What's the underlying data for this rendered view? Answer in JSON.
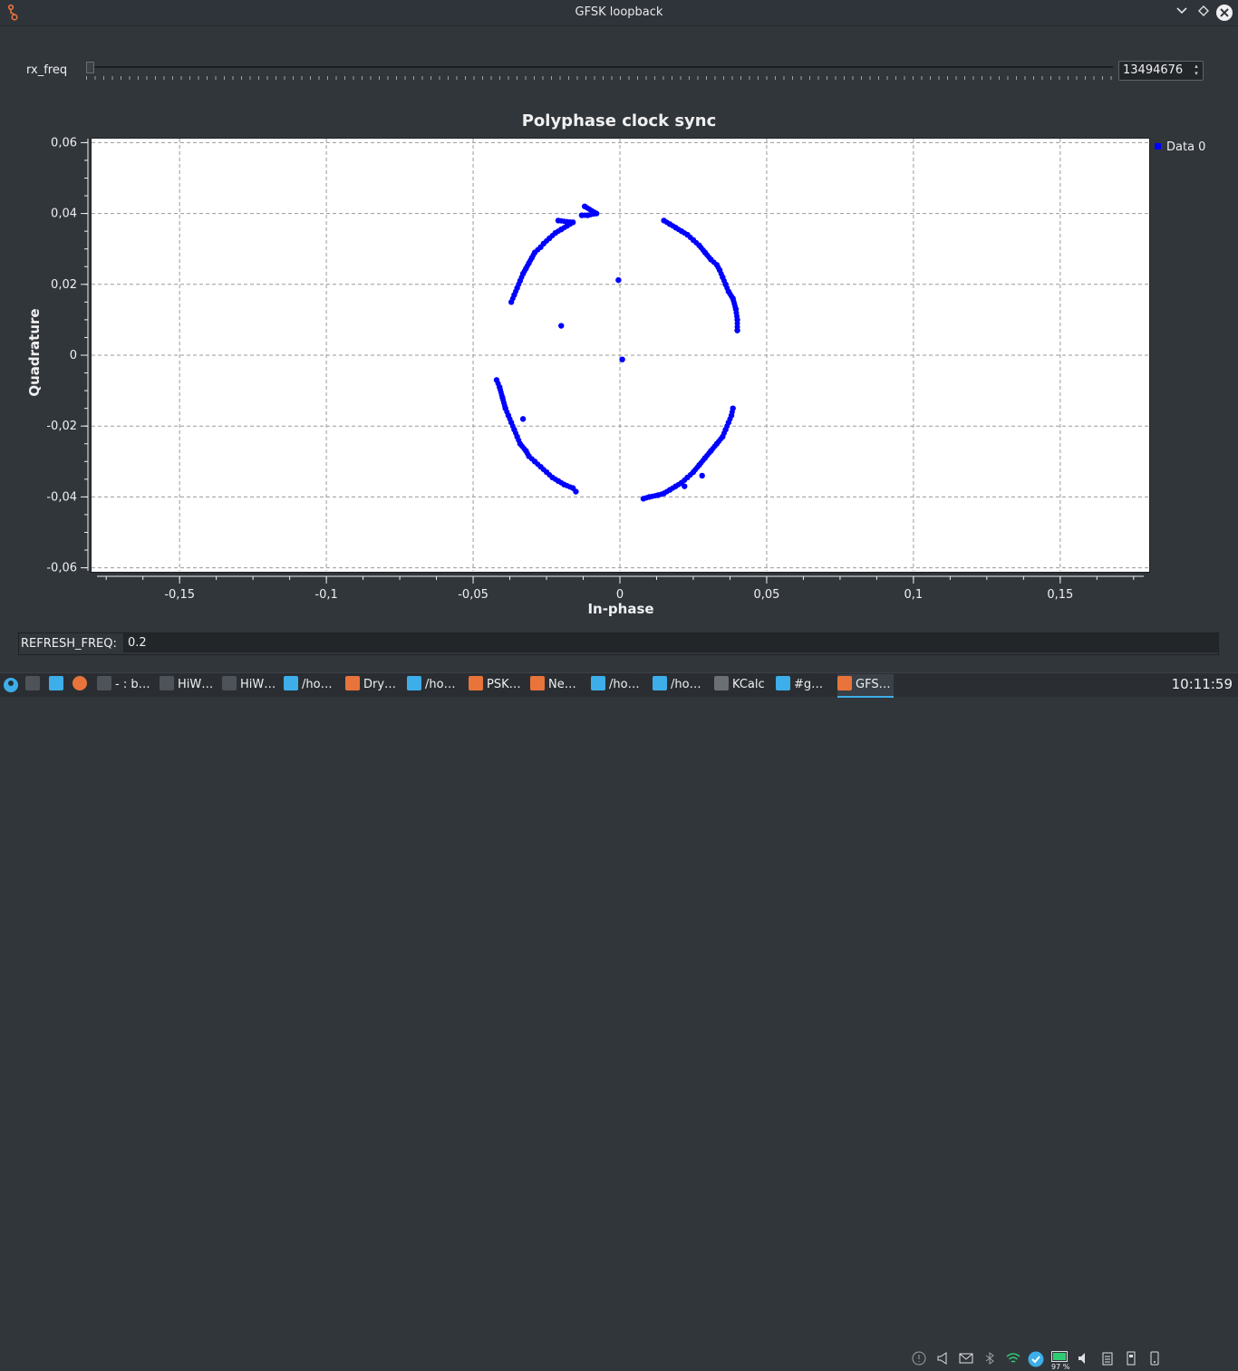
{
  "window": {
    "title": "GFSK loopback",
    "colors": {
      "accent": "#3daee9",
      "point": "#0000ff",
      "app_icon": "#e8743b"
    }
  },
  "controls": {
    "rx_freq_label": "rx_freq",
    "rx_freq_value": "13494676",
    "refresh_label": "REFRESH_FREQ:",
    "refresh_value": "0.2"
  },
  "chart_data": {
    "type": "scatter",
    "title": "Polyphase clock sync",
    "xlabel": "In-phase",
    "ylabel": "Quadrature",
    "xlim": [
      -0.18,
      0.18
    ],
    "ylim": [
      -0.06,
      0.06
    ],
    "xticks": [
      -0.15,
      -0.1,
      -0.05,
      0,
      0.05,
      0.1,
      0.15
    ],
    "xtick_labels": [
      "-0,15",
      "-0,1",
      "-0,05",
      "0",
      "0,05",
      "0,1",
      "0,15"
    ],
    "yticks": [
      0.06,
      0.04,
      0.02,
      0,
      -0.02,
      -0.04,
      -0.06
    ],
    "ytick_labels": [
      "0,06",
      "0,04",
      "0,02",
      "0",
      "-0,02",
      "-0,04",
      "-0,06"
    ],
    "grid": true,
    "legend": "right",
    "series": [
      {
        "name": "Data 0",
        "color": "#0000ff",
        "points": [
          [
            -0.037,
            0.015
          ],
          [
            -0.036,
            0.017
          ],
          [
            -0.035,
            0.019
          ],
          [
            -0.034,
            0.021
          ],
          [
            -0.033,
            0.023
          ],
          [
            -0.032,
            0.0245
          ],
          [
            -0.031,
            0.026
          ],
          [
            -0.03,
            0.0275
          ],
          [
            -0.029,
            0.029
          ],
          [
            -0.027,
            0.0305
          ],
          [
            -0.026,
            0.0315
          ],
          [
            -0.024,
            0.033
          ],
          [
            -0.022,
            0.0345
          ],
          [
            -0.02,
            0.0355
          ],
          [
            -0.018,
            0.0365
          ],
          [
            -0.016,
            0.0375
          ],
          [
            -0.021,
            0.038
          ],
          [
            -0.013,
            0.0395
          ],
          [
            -0.011,
            0.0395
          ],
          [
            -0.008,
            0.04
          ],
          [
            -0.012,
            0.042
          ],
          [
            0.015,
            0.038
          ],
          [
            0.017,
            0.037
          ],
          [
            0.019,
            0.036
          ],
          [
            0.021,
            0.035
          ],
          [
            0.023,
            0.034
          ],
          [
            0.025,
            0.0325
          ],
          [
            0.027,
            0.031
          ],
          [
            0.029,
            0.029
          ],
          [
            0.031,
            0.027
          ],
          [
            0.033,
            0.0255
          ],
          [
            0.034,
            0.024
          ],
          [
            0.035,
            0.022
          ],
          [
            0.036,
            0.02
          ],
          [
            0.037,
            0.018
          ],
          [
            0.0385,
            0.016
          ],
          [
            0.0395,
            0.013
          ],
          [
            0.04,
            0.01
          ],
          [
            0.04,
            0.007
          ],
          [
            -0.042,
            -0.007
          ],
          [
            -0.041,
            -0.009
          ],
          [
            -0.04,
            -0.012
          ],
          [
            -0.039,
            -0.015
          ],
          [
            -0.038,
            -0.017
          ],
          [
            -0.037,
            -0.019
          ],
          [
            -0.036,
            -0.021
          ],
          [
            -0.035,
            -0.023
          ],
          [
            -0.034,
            -0.025
          ],
          [
            -0.032,
            -0.027
          ],
          [
            -0.031,
            -0.0285
          ],
          [
            -0.029,
            -0.03
          ],
          [
            -0.027,
            -0.0315
          ],
          [
            -0.025,
            -0.033
          ],
          [
            -0.023,
            -0.0345
          ],
          [
            -0.021,
            -0.0355
          ],
          [
            -0.019,
            -0.0365
          ],
          [
            -0.016,
            -0.0375
          ],
          [
            -0.015,
            -0.0385
          ],
          [
            -0.033,
            -0.018
          ],
          [
            0.008,
            -0.0405
          ],
          [
            0.01,
            -0.04
          ],
          [
            0.013,
            -0.0395
          ],
          [
            0.015,
            -0.039
          ],
          [
            0.017,
            -0.038
          ],
          [
            0.019,
            -0.037
          ],
          [
            0.021,
            -0.036
          ],
          [
            0.023,
            -0.0345
          ],
          [
            0.025,
            -0.033
          ],
          [
            0.027,
            -0.031
          ],
          [
            0.029,
            -0.029
          ],
          [
            0.031,
            -0.027
          ],
          [
            0.033,
            -0.025
          ],
          [
            0.035,
            -0.023
          ],
          [
            0.036,
            -0.021
          ],
          [
            0.037,
            -0.019
          ],
          [
            0.038,
            -0.017
          ],
          [
            0.0385,
            -0.015
          ],
          [
            0.028,
            -0.034
          ],
          [
            0.022,
            -0.037
          ],
          [
            -0.0005,
            0.0212
          ],
          [
            -0.02,
            0.0083
          ],
          [
            0.0008,
            -0.0012
          ]
        ]
      }
    ]
  },
  "taskbar": {
    "items": [
      {
        "label": "- : b…"
      },
      {
        "label": "HiW…"
      },
      {
        "label": "HiW…"
      },
      {
        "label": "/ho…"
      },
      {
        "label": "Dry…"
      },
      {
        "label": "/ho…"
      },
      {
        "label": "PSK…"
      },
      {
        "label": "Ne…"
      },
      {
        "label": "/ho…"
      },
      {
        "label": "/ho…"
      },
      {
        "label": "KCalc"
      },
      {
        "label": "#g…"
      },
      {
        "label": "GFS…"
      }
    ],
    "battery": "97 %",
    "clock": "10:11:59"
  }
}
